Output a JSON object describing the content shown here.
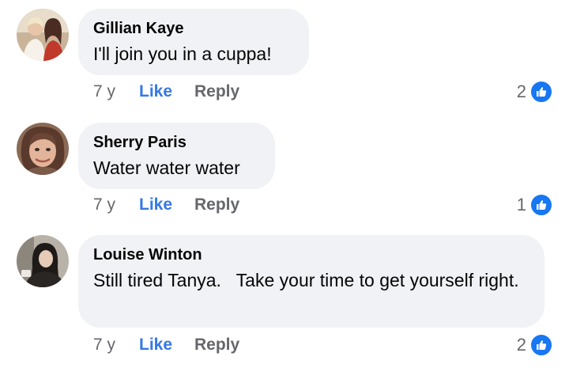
{
  "comments": [
    {
      "author": "Gillian Kaye",
      "text": "I'll join you in a cuppa!",
      "time": "7 y",
      "like_label": "Like",
      "reply_label": "Reply",
      "reaction_count": "2",
      "reaction_icon": "thumbs-up-icon"
    },
    {
      "author": "Sherry Paris",
      "text": "Water water water",
      "time": "7 y",
      "like_label": "Like",
      "reply_label": "Reply",
      "reaction_count": "1",
      "reaction_icon": "thumbs-up-icon"
    },
    {
      "author": "Louise Winton",
      "text": "Still tired Tanya.   Take your time to get yourself right.",
      "time": "7 y",
      "like_label": "Like",
      "reply_label": "Reply",
      "reaction_count": "2",
      "reaction_icon": "thumbs-up-icon"
    }
  ],
  "colors": {
    "bubble": "#f0f2f5",
    "link_blue": "#3578e5",
    "meta_gray": "#65676b",
    "reaction_blue": "#1877f2"
  }
}
